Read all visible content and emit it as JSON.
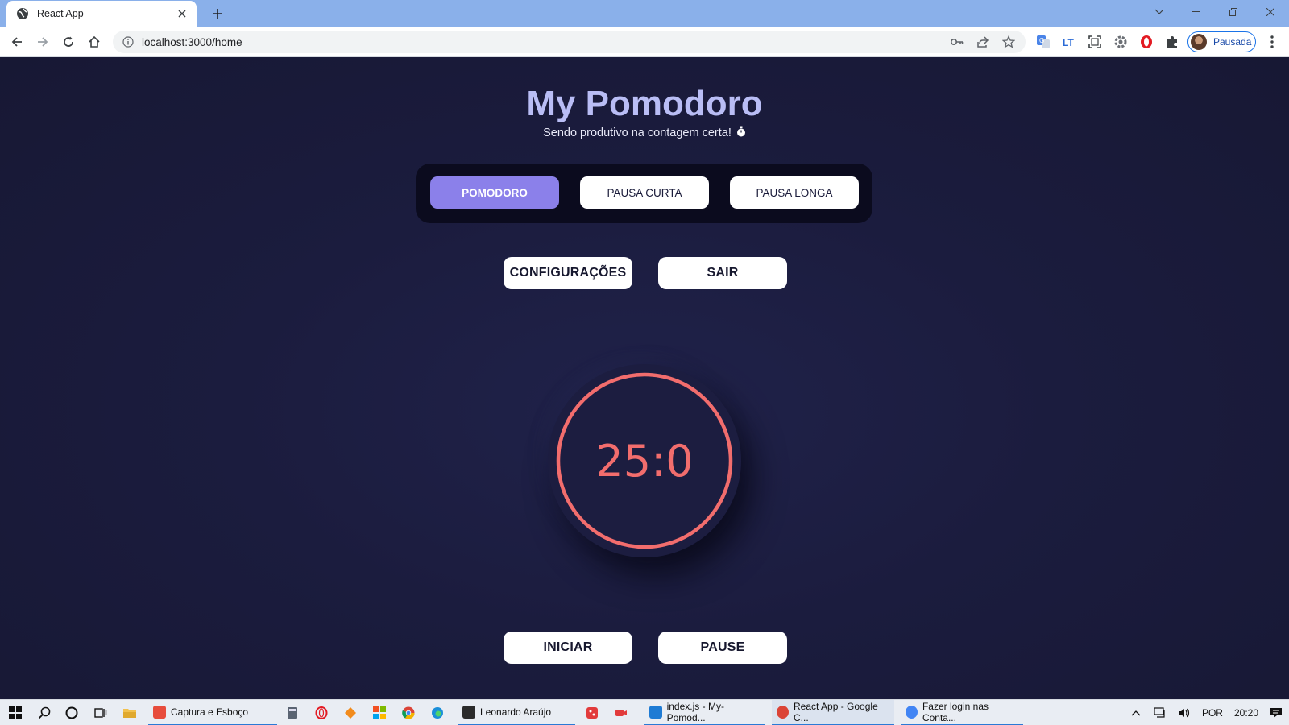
{
  "browser": {
    "tab_title": "React App",
    "url": "localhost:3000/home",
    "profile_label": "Pausada"
  },
  "app": {
    "title": "My Pomodoro",
    "subtitle": "Sendo produtivo na contagem certa!",
    "modes": [
      {
        "label": "POMODORO",
        "active": true
      },
      {
        "label": "PAUSA CURTA",
        "active": false
      },
      {
        "label": "PAUSA LONGA",
        "active": false
      }
    ],
    "settings_label": "CONFIGURAÇÕES",
    "logout_label": "SAIR",
    "timer_value": "25:0",
    "timer_progress": 1.0,
    "start_label": "INICIAR",
    "pause_label": "PAUSE",
    "colors": {
      "background": "#1b1c3b",
      "accent": "#8b80ea",
      "timer": "#f26d6d",
      "title": "#b9bdf5"
    }
  },
  "taskbar": {
    "apps": [
      {
        "label": "Captura e Esboço"
      },
      {
        "label": "Leonardo Araújo"
      },
      {
        "label": "index.js - My-Pomod..."
      },
      {
        "label": "React App - Google C..."
      },
      {
        "label": "Fazer login nas Conta..."
      }
    ],
    "language": "POR",
    "time": "20:20"
  }
}
